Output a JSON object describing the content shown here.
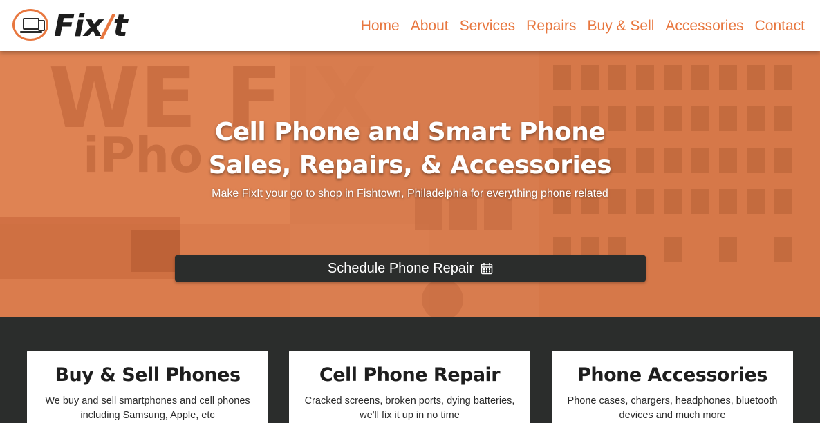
{
  "brand": {
    "name_main": "Fix",
    "name_slash": "/",
    "name_end": "t",
    "accent": "#e8773f",
    "dark": "#2b2d2c"
  },
  "nav": {
    "items": [
      {
        "label": "Home"
      },
      {
        "label": "About"
      },
      {
        "label": "Services"
      },
      {
        "label": "Repairs"
      },
      {
        "label": "Buy & Sell"
      },
      {
        "label": "Accessories"
      },
      {
        "label": "Contact"
      }
    ]
  },
  "hero": {
    "title_line1": "Cell Phone and Smart Phone",
    "title_line2": "Sales, Repairs, & Accessories",
    "subtitle": "Make FixIt your go to shop in Fishtown, Philadelphia for everything phone related",
    "cta_label": "Schedule Phone Repair",
    "cta_icon": "calendar-icon"
  },
  "cards": [
    {
      "title": "Buy & Sell Phones",
      "line1": "We buy and sell smartphones and cell phones",
      "line2": "including Samsung, Apple, etc"
    },
    {
      "title": "Cell Phone Repair",
      "line1": "Cracked screens, broken ports, dying batteries,",
      "line2": "we'll fix it up in no time"
    },
    {
      "title": "Phone Accessories",
      "line1": "Phone cases, chargers, headphones, bluetooth",
      "line2": "devices and much more"
    }
  ]
}
